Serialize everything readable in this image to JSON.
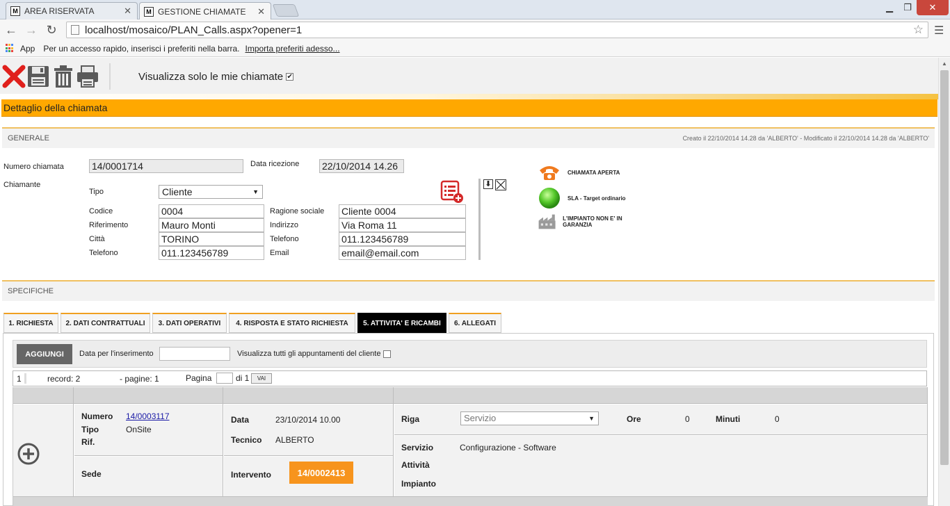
{
  "browser": {
    "tabs": [
      {
        "label": "AREA RISERVATA",
        "favicon": "M"
      },
      {
        "label": "GESTIONE CHIAMATE",
        "favicon": "M"
      }
    ],
    "url": "localhost/mosaico/PLAN_Calls.aspx?opener=1",
    "bookmarks": {
      "apps_label": "App",
      "hint": "Per un accesso rapido, inserisci i preferiti nella barra.",
      "import_link": "Importa preferiti adesso..."
    },
    "window_controls": {
      "minimize": "▁",
      "restore": "❐",
      "close": "✕"
    }
  },
  "toolbar": {
    "icons": [
      "close-icon",
      "save-icon",
      "trash-icon",
      "print-icon"
    ],
    "only_mine_label": "Visualizza solo le mie chiamate",
    "only_mine_checked": "✔"
  },
  "detail_title": "Dettaglio della chiamata",
  "generale": {
    "title": "GENERALE",
    "meta": "Creato il 22/10/2014 14.28 da 'ALBERTO' - Modificato il 22/10/2014 14.28 da 'ALBERTO'",
    "numero_label": "Numero chiamata",
    "numero_value": "14/0001714",
    "data_label": "Data ricezione",
    "data_value": "22/10/2014 14.26",
    "chiamante_label": "Chiamante",
    "tipo_label": "Tipo",
    "tipo_value": "Cliente",
    "codice_label": "Codice",
    "codice_value": "0004",
    "ragione_label": "Ragione sociale",
    "ragione_value": "Cliente 0004",
    "riferimento_label": "Riferimento",
    "riferimento_value": "Mauro Monti",
    "indirizzo_label": "Indirizzo",
    "indirizzo_value": "Via Roma 11",
    "citta_label": "Città",
    "citta_value": "TORINO",
    "telefono2_label": "Telefono",
    "telefono2_value": "011.123456789",
    "telefono_label": "Telefono",
    "telefono_value": "011.123456789",
    "email_label": "Email",
    "email_value": "email@email.com"
  },
  "status": {
    "chiamata": "CHIAMATA APERTA",
    "sla": "SLA - Target ordinario",
    "garanzia": "L'IMPIANTO NON E' IN GARANZIA"
  },
  "specifiche": {
    "title": "SPECIFICHE",
    "tabs": [
      "1. RICHIESTA",
      "2. DATI CONTRATTUALI",
      "3. DATI OPERATIVI",
      "4. RISPOSTA E STATO RICHIESTA",
      "5. ATTIVITA' E RICAMBI",
      "6. ALLEGATI"
    ],
    "active_tab": 4
  },
  "activities": {
    "add_button": "AGGIUNGI",
    "data_ins_label": "Data per l'inserimento",
    "show_all_label": "Visualizza tutti gli appuntamenti del cliente",
    "pager": {
      "page_index": "1",
      "record_label": "record: 2",
      "pages_label": "- pagine: 1",
      "pagina_label": "Pagina",
      "di_label": "di 1",
      "vai": "VAI"
    },
    "row": {
      "numero_label": "Numero",
      "numero_value": "14/0003117",
      "tipo_label": "Tipo",
      "tipo_value": "OnSite",
      "rif_label": "Rif.",
      "sede_label": "Sede",
      "data_label": "Data",
      "data_value": "23/10/2014 10.00",
      "tecnico_label": "Tecnico",
      "tecnico_value": "ALBERTO",
      "intervento_label": "Intervento",
      "intervento_value": "14/0002413",
      "riga_label": "Riga",
      "riga_value": "Servizio",
      "ore_label": "Ore",
      "ore_value": "0",
      "minuti_label": "Minuti",
      "minuti_value": "0",
      "servizio_label": "Servizio",
      "servizio_value": "Configurazione - Software",
      "attivita_label": "Attività",
      "impianto_label": "Impianto"
    }
  },
  "colors": {
    "accent": "#ffa800",
    "intervento": "#f7941d",
    "sla_green": "#55c82a",
    "phone_orange": "#f07a1e"
  }
}
